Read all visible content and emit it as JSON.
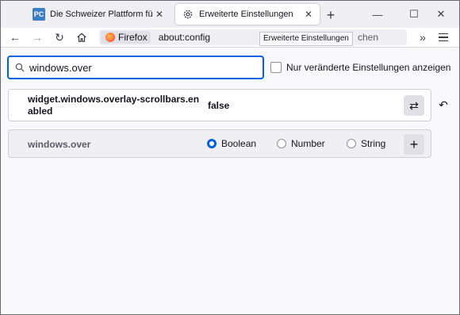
{
  "tabs": [
    {
      "label": "Die Schweizer Plattform für Computer",
      "favicon": "PC",
      "close": "✕"
    },
    {
      "label": "Erweiterte Einstellungen",
      "close": "✕"
    }
  ],
  "newtab_label": "+",
  "window_controls": {
    "minimize": "—",
    "maximize": "☐",
    "close": "✕"
  },
  "nav": {
    "back": "←",
    "forward": "→",
    "reload": "↻",
    "overflow": "»"
  },
  "urlbar": {
    "identity_label": "Firefox",
    "address": "about:config",
    "search_hint": "chen"
  },
  "tooltip": "Erweiterte Einstellungen",
  "config": {
    "search_value": "windows.over",
    "modified_only_label": "Nur veränderte Einstellungen anzeigen",
    "prefs": [
      {
        "name": "widget.windows.overlay-scrollbars.enabled",
        "value": "false",
        "toggle_icon": "⇄",
        "reset_icon": "↶"
      }
    ],
    "new_pref": {
      "name": "windows.over",
      "types": [
        "Boolean",
        "Number",
        "String"
      ],
      "selected": "Boolean",
      "add_icon": "+"
    }
  },
  "colors": {
    "accent": "#0061e0",
    "chrome": "#f0f0f4"
  }
}
